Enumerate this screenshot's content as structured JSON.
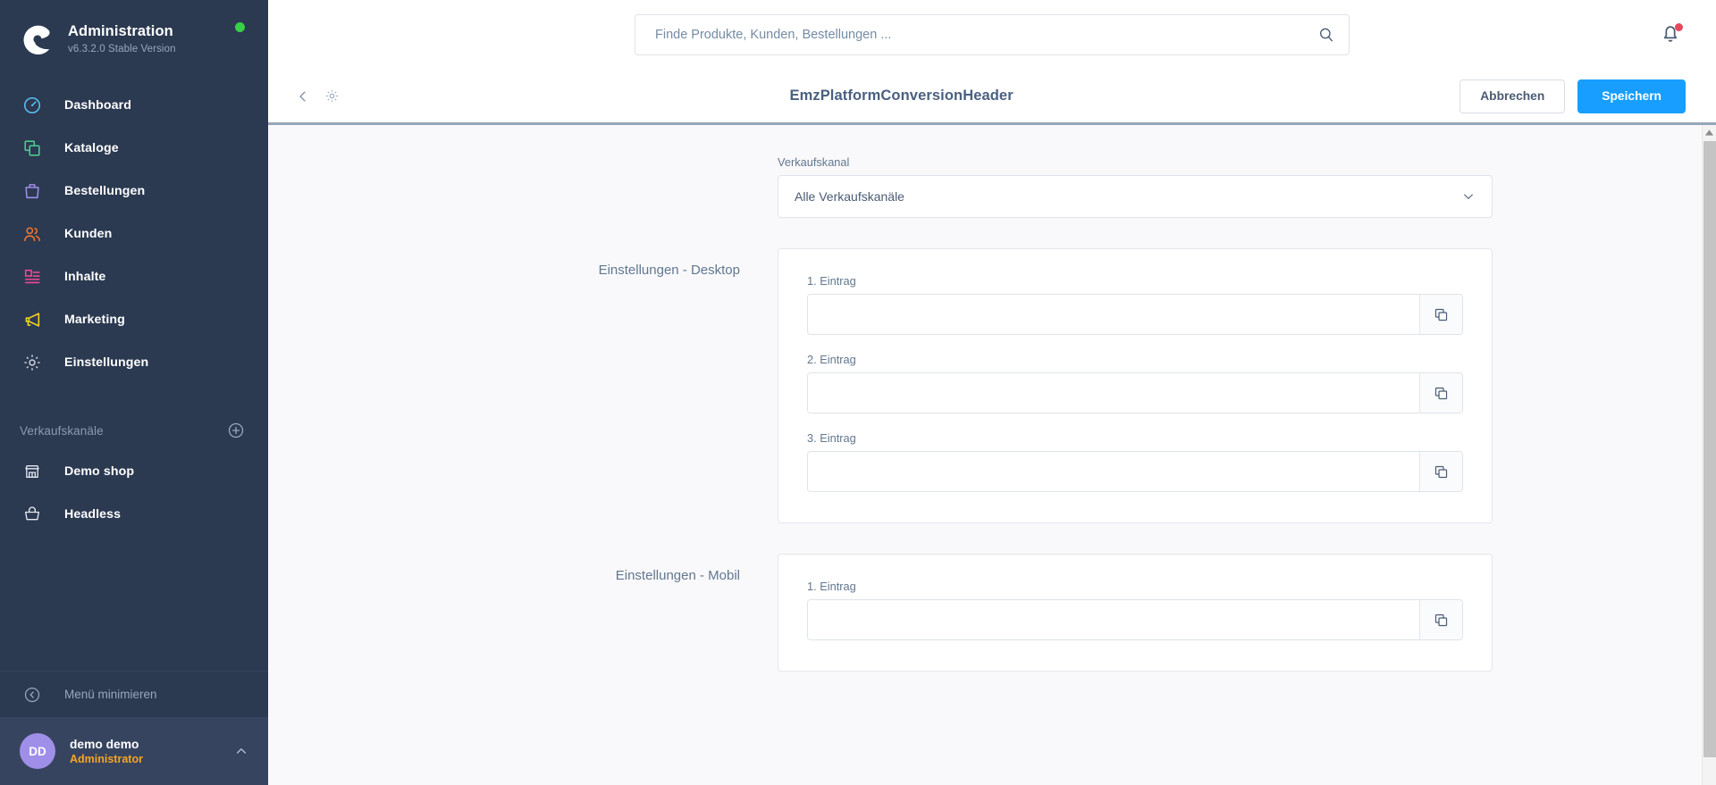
{
  "sidebar": {
    "brand": {
      "logo_icon": "shopware-logo-icon",
      "title": "Administration",
      "version": "v6.3.2.0 Stable Version",
      "status_dot": "online-status-dot",
      "status_color": "#37d046"
    },
    "nav_items": [
      {
        "label": "Dashboard",
        "icon": "dashboard-icon",
        "color": "#56c1f0"
      },
      {
        "label": "Kataloge",
        "icon": "catalog-icon",
        "color": "#4ecb8e"
      },
      {
        "label": "Bestellungen",
        "icon": "orders-bag-icon",
        "color": "#9f8fe8"
      },
      {
        "label": "Kunden",
        "icon": "customers-icon",
        "color": "#f2762e"
      },
      {
        "label": "Inhalte",
        "icon": "content-icon",
        "color": "#ed4992"
      },
      {
        "label": "Marketing",
        "icon": "megaphone-icon",
        "color": "#f5d523"
      },
      {
        "label": "Einstellungen",
        "icon": "gear-icon",
        "color": "#c5ccd8"
      }
    ],
    "sales_channels": {
      "title": "Verkaufskanäle",
      "add_icon": "plus-circle-icon",
      "items": [
        {
          "label": "Demo shop",
          "icon": "storefront-icon"
        },
        {
          "label": "Headless",
          "icon": "basket-icon"
        }
      ]
    },
    "minimize": {
      "label": "Menü minimieren",
      "icon": "chevron-left-circle-icon"
    },
    "user": {
      "initials": "DD",
      "name": "demo demo",
      "role": "Administrator",
      "role_color": "#f5a623",
      "avatar_color": "#9f8fe8",
      "chevron_icon": "chevron-up-icon"
    }
  },
  "topbar": {
    "search": {
      "placeholder": "Finde Produkte, Kunden, Bestellungen ...",
      "value": "",
      "icon": "search-icon"
    },
    "notifications": {
      "icon": "bell-icon",
      "has_unread": true,
      "badge_color": "#e5495e"
    }
  },
  "pagehead": {
    "back_icon": "chevron-left-icon",
    "settings_icon": "gear-icon",
    "title": "EmzPlatformConversionHeader",
    "cancel_label": "Abbrechen",
    "save_label": "Speichern",
    "primary_color": "#189eff"
  },
  "content": {
    "sales_channel": {
      "label": "Verkaufskanal",
      "selected": "Alle Verkaufskanäle",
      "chevron_icon": "chevron-down-icon"
    },
    "sections": [
      {
        "title": "Einstellungen - Desktop",
        "entries": [
          {
            "label": "1. Eintrag",
            "value": "",
            "copy_icon": "copy-icon"
          },
          {
            "label": "2. Eintrag",
            "value": "",
            "copy_icon": "copy-icon"
          },
          {
            "label": "3. Eintrag",
            "value": "",
            "copy_icon": "copy-icon"
          }
        ]
      },
      {
        "title": "Einstellungen - Mobil",
        "entries": [
          {
            "label": "1. Eintrag",
            "value": "",
            "copy_icon": "copy-icon"
          }
        ]
      }
    ]
  },
  "scrollbar": {
    "up_arrow_icon": "caret-up-icon"
  }
}
